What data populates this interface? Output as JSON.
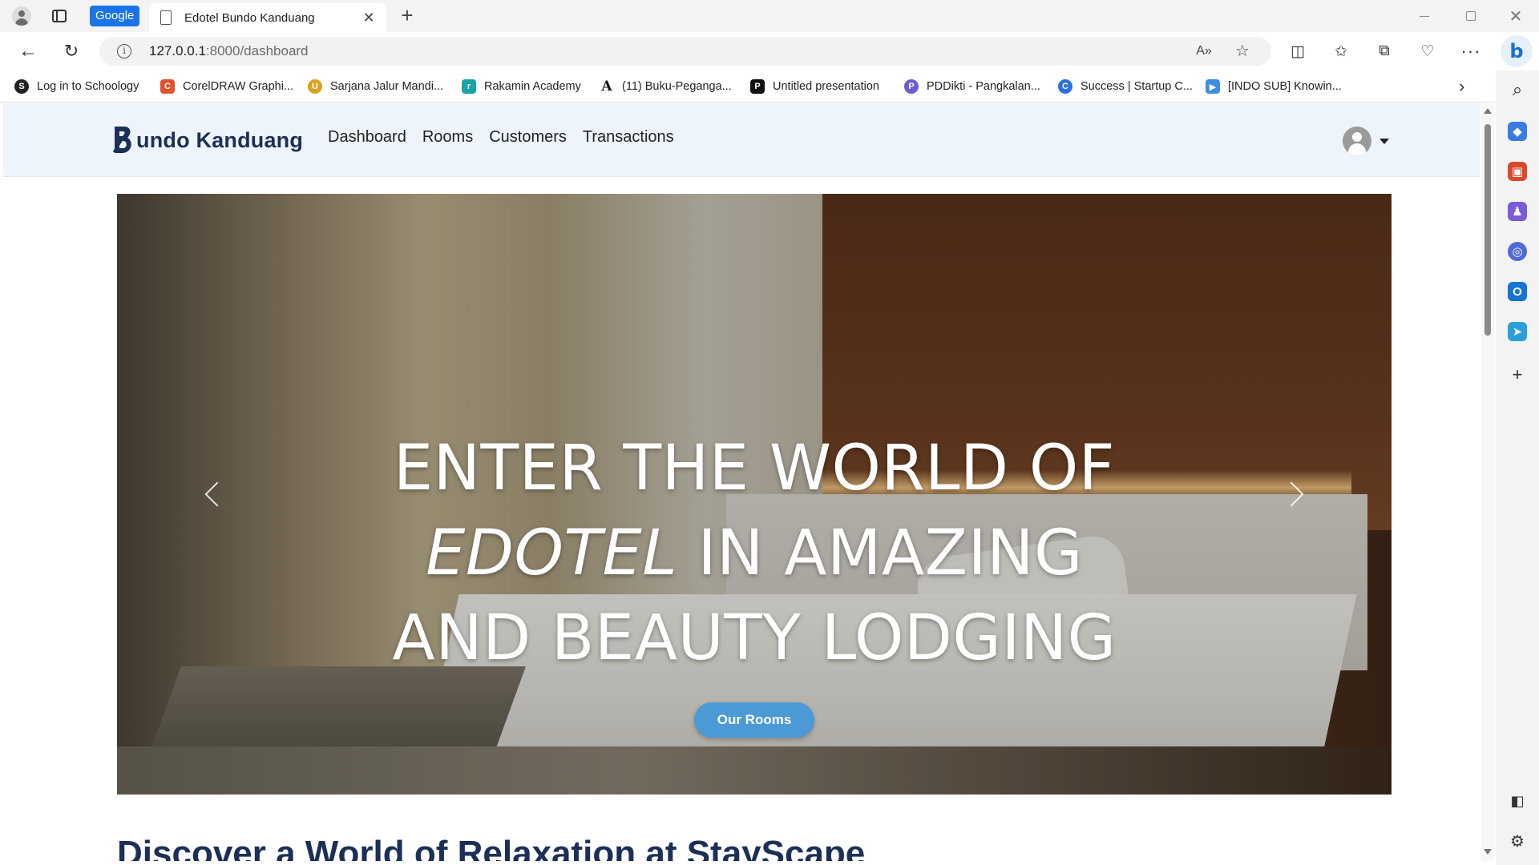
{
  "browser": {
    "google_badge": "Google",
    "tab_title": "Edotel Bundo Kanduang",
    "url_host": "127.0.0.1",
    "url_path": ":8000/dashboard",
    "bookmarks": [
      {
        "label": "Log in to Schoology",
        "icon": "schoology-icon",
        "color": "#222222"
      },
      {
        "label": "CorelDRAW Graphi...",
        "icon": "coreldraw-icon",
        "color": "#e0532d"
      },
      {
        "label": "Sarjana Jalur Mandi...",
        "icon": "university-icon",
        "color": "#d9a21b"
      },
      {
        "label": "Rakamin Academy",
        "icon": "rakamin-icon",
        "color": "#1aa5a5"
      },
      {
        "label": "(11) Buku-Peganga...",
        "icon": "academia-icon",
        "color": "#ffffff"
      },
      {
        "label": "Untitled presentation",
        "icon": "pitch-icon",
        "color": "#111111"
      },
      {
        "label": "PDDikti - Pangkalan...",
        "icon": "pddikti-icon",
        "color": "#6d5bd0"
      },
      {
        "label": "Success | Startup C...",
        "icon": "startup-icon",
        "color": "#2d6fe0"
      },
      {
        "label": "[INDO SUB] Knowin...",
        "icon": "video-icon",
        "color": "#3b8ee0"
      }
    ]
  },
  "site": {
    "brand_name": "undo Kanduang",
    "brand_initial": "B",
    "brand_color": "#1b2f57",
    "nav": [
      "Dashboard",
      "Rooms",
      "Customers",
      "Transactions"
    ]
  },
  "hero": {
    "line1": "ENTER THE WORLD OF",
    "line2_em": "EDOTEL",
    "line2_rest": " IN AMAZING",
    "line3": "AND BEAUTY LODGING",
    "button_label": "Our Rooms",
    "button_color": "#4b9ad5"
  },
  "section": {
    "heading": "Discover a World of Relaxation at StayScape"
  }
}
